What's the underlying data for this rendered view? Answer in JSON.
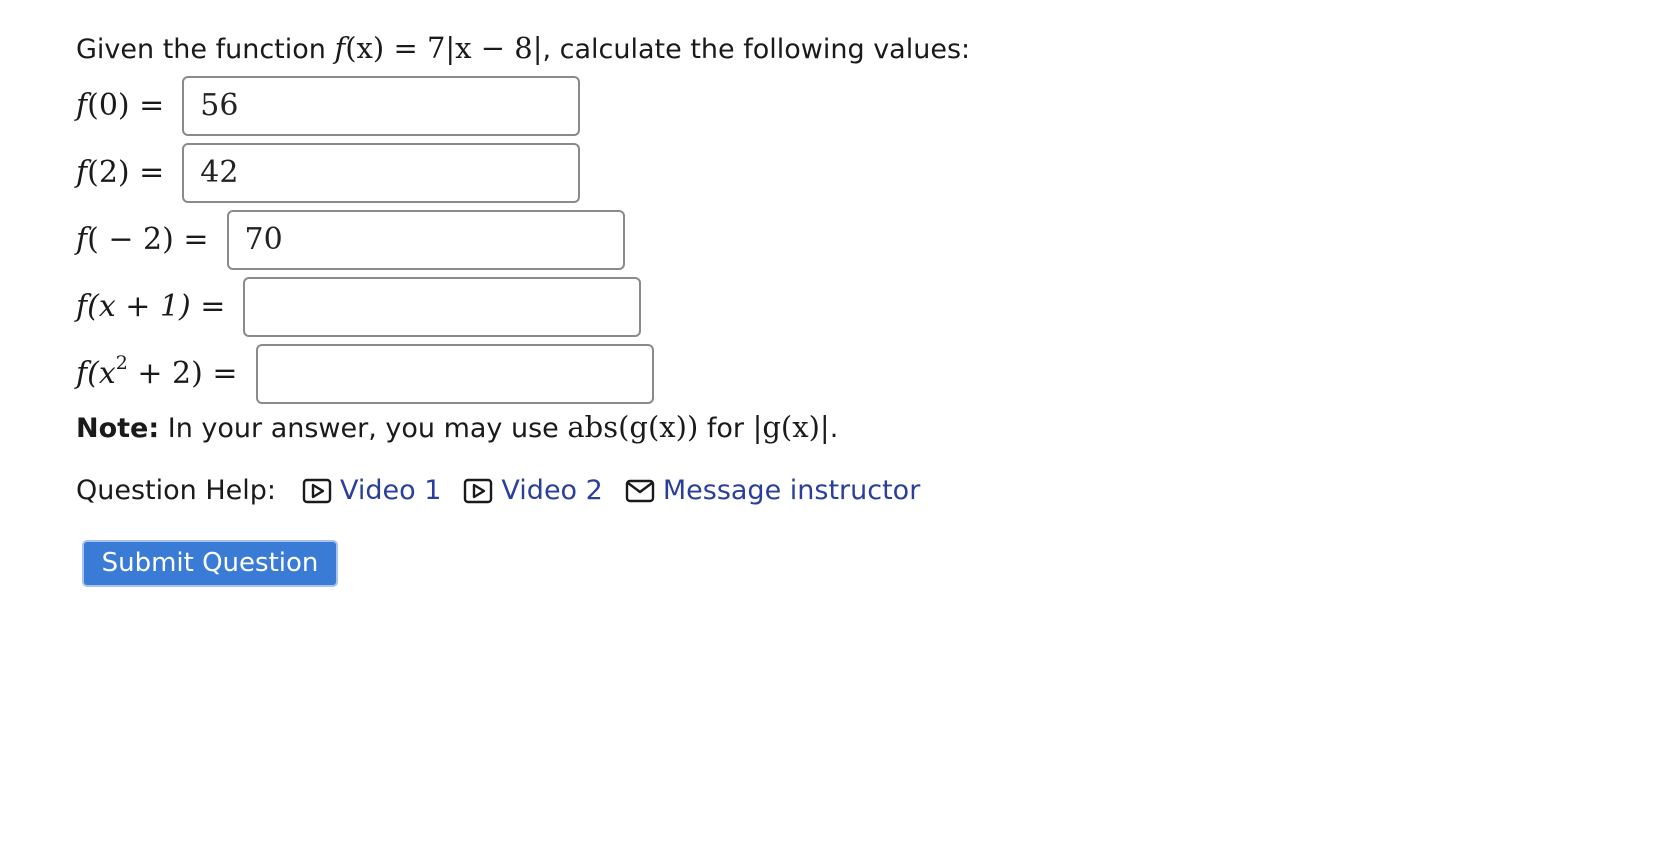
{
  "question": {
    "intro_prefix": "Given the function",
    "function_lhs": "f",
    "function_arg": "(x)",
    "function_rhs": "= 7|x − 8|",
    "intro_suffix": ", calculate the following values:"
  },
  "answers": [
    {
      "label_fn": "f",
      "label_arg": "(0)",
      "label_sup": "",
      "label_tail": "",
      "equals": "=",
      "value": "56"
    },
    {
      "label_fn": "f",
      "label_arg": "(2)",
      "label_sup": "",
      "label_tail": "",
      "equals": "=",
      "value": "42"
    },
    {
      "label_fn": "f",
      "label_arg": "( − 2)",
      "label_sup": "",
      "label_tail": "",
      "equals": "=",
      "value": "70"
    },
    {
      "label_fn": "f",
      "label_arg": "(x + 1)",
      "label_sup": "",
      "label_tail": "",
      "equals": "=",
      "value": ""
    },
    {
      "label_fn": "f",
      "label_arg": "(x",
      "label_sup": "2",
      "label_tail": " + 2)",
      "equals": "=",
      "value": ""
    }
  ],
  "note": {
    "bold": "Note:",
    "text_before": " In your answer, you may use ",
    "code": "abs(g(x))",
    "text_middle": " for ",
    "abs_expr": "|g(x)|",
    "text_after": "."
  },
  "help": {
    "label": "Question Help:",
    "links": [
      {
        "icon": "video-icon",
        "label": "Video 1"
      },
      {
        "icon": "video-icon",
        "label": "Video 2"
      },
      {
        "icon": "mail-icon",
        "label": "Message instructor"
      }
    ]
  },
  "submit_label": "Submit Question",
  "colors": {
    "link": "#2a3f9a",
    "button": "#3a7bd5"
  }
}
